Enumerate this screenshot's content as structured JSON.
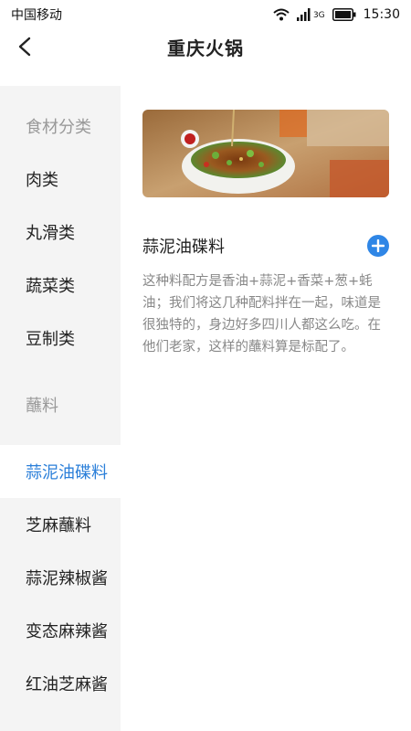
{
  "status_bar": {
    "carrier": "中国移动",
    "network": "3G",
    "time": "15:30"
  },
  "header": {
    "title": "重庆火锅"
  },
  "sidebar": {
    "items": [
      {
        "label": "食材分类",
        "type": "section"
      },
      {
        "label": "肉类",
        "type": "item"
      },
      {
        "label": "丸滑类",
        "type": "item"
      },
      {
        "label": "蔬菜类",
        "type": "item"
      },
      {
        "label": "豆制类",
        "type": "item"
      },
      {
        "label": "蘸料",
        "type": "section"
      },
      {
        "label": "蒜泥油碟料",
        "type": "item",
        "active": true
      },
      {
        "label": "芝麻蘸料",
        "type": "item"
      },
      {
        "label": "蒜泥辣椒酱",
        "type": "item"
      },
      {
        "label": "变态麻辣酱",
        "type": "item"
      },
      {
        "label": "红油芝麻酱",
        "type": "item"
      }
    ]
  },
  "detail": {
    "image_alt": "dipping-sauce-bowl-photo",
    "title": "蒜泥油碟料",
    "description": "这种料配方是香油+蒜泥+香菜+葱+蚝油；我们将这几种配料拌在一起，味道是很独特的，身边好多四川人都这么吃。在他们老家，这样的蘸料算是标配了。"
  },
  "colors": {
    "accent": "#2b7fd9",
    "add_button": "#2f86e6",
    "sidebar_bg": "#f4f4f4"
  }
}
